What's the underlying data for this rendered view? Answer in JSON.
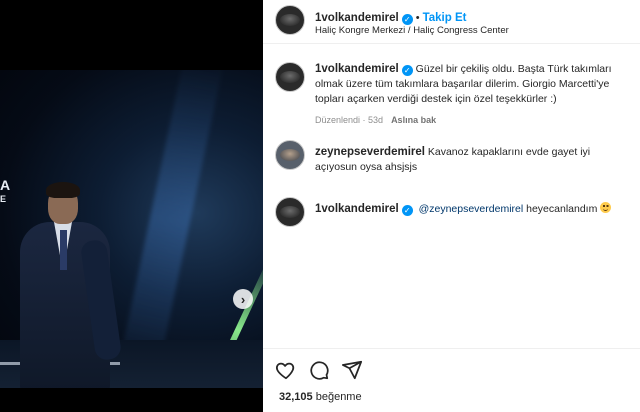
{
  "post": {
    "author": "1volkandemirel",
    "follow_label": "Takip Et",
    "separator": "•",
    "location": "Haliç Kongre Merkezi / Haliç Congress Center"
  },
  "media": {
    "stage_text": "A",
    "stage_sub": "E",
    "next_button": "›"
  },
  "comments": [
    {
      "username": "1volkandemirel",
      "verified": true,
      "line1": "Güzel bir çekiliş oldu. Başta Türk takımları",
      "line2": "olmak üzere tüm takımlara başarılar dilerim. Giorgio Marcetti'ye",
      "line3": "topları açarken verdiği destek için özel teşekkürler :)",
      "edited": "Düzenlendi",
      "age": "53d",
      "translate": "Aslına bak"
    },
    {
      "username": "zeynepseverdemirel",
      "verified": false,
      "line1": "Kavanoz kapaklarını evde gayet iyi",
      "line2": "açıyosun oysa ahsjsjs"
    },
    {
      "username": "1volkandemirel",
      "verified": true,
      "mention": "@zeynepseverdemirel",
      "text": "heyecanlandım",
      "emoji": "smile-emoji"
    }
  ],
  "footer": {
    "likes_count": "32,105",
    "likes_label": "beğenme"
  },
  "icons": {
    "verified": "verified-badge-icon",
    "like": "heart-icon",
    "comment": "comment-icon",
    "share": "send-icon",
    "next": "chevron-right-icon"
  },
  "colors": {
    "accent": "#0095f6",
    "text": "#262626",
    "muted": "#8e8e8e",
    "mention": "#00376b"
  }
}
